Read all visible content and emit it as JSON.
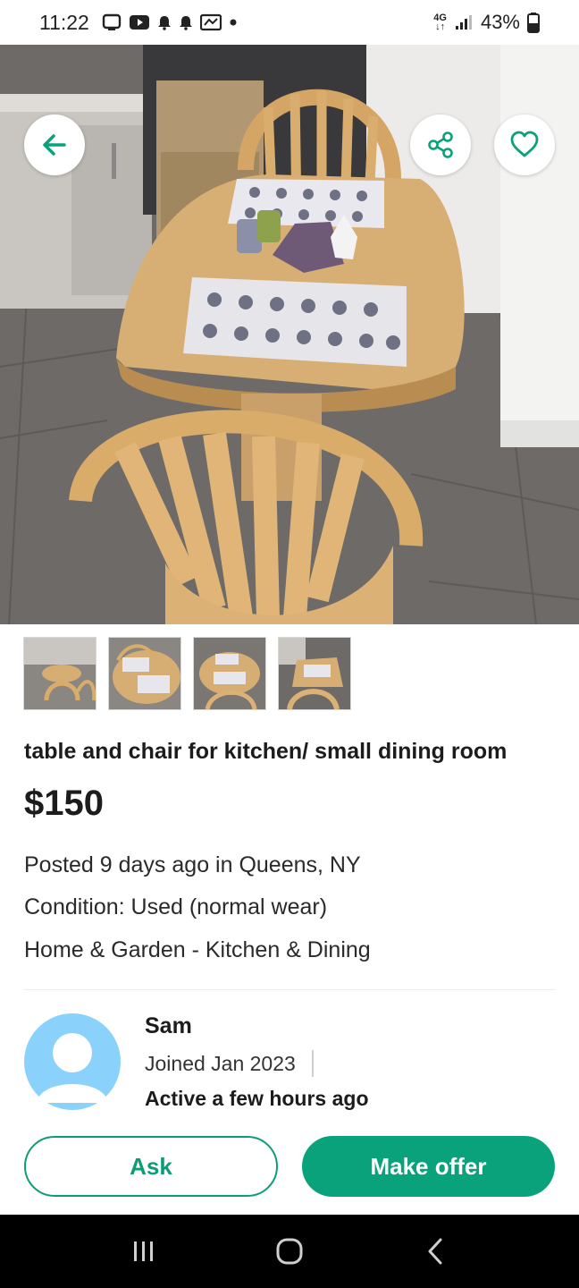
{
  "status_bar": {
    "time": "11:22",
    "network_top": "4G",
    "battery": "43%",
    "left_icons": [
      "tv-icon",
      "youtube-icon",
      "notification-bell-icon",
      "notification-bell-icon",
      "cast-icon",
      "dot-icon"
    ],
    "right_icons": [
      "network-4g-icon",
      "signal-icon",
      "battery-icon"
    ]
  },
  "hero": {
    "actions": {
      "back": "arrow-left-icon",
      "share": "share-icon",
      "favorite": "heart-icon"
    }
  },
  "thumbnails": [
    {
      "name": "thumbnail-1"
    },
    {
      "name": "thumbnail-2"
    },
    {
      "name": "thumbnail-3"
    },
    {
      "name": "thumbnail-4"
    }
  ],
  "listing": {
    "title": "table and chair for kitchen/ small dining room",
    "price": "$150",
    "posted": "Posted 9 days ago in Queens, NY",
    "condition": "Condition: Used (normal wear)",
    "category": "Home & Garden - Kitchen & Dining"
  },
  "seller": {
    "name": "Sam",
    "joined": "Joined  Jan 2023",
    "active": "Active a few hours ago"
  },
  "actions": {
    "ask_label": "Ask",
    "offer_label": "Make offer"
  },
  "colors": {
    "accent": "#0aa27a",
    "avatar_bg": "#8ad2fb",
    "nav_bar": "#000000"
  },
  "nav_bar": {
    "icons": [
      "recent-apps-icon",
      "home-icon",
      "back-nav-icon"
    ]
  }
}
